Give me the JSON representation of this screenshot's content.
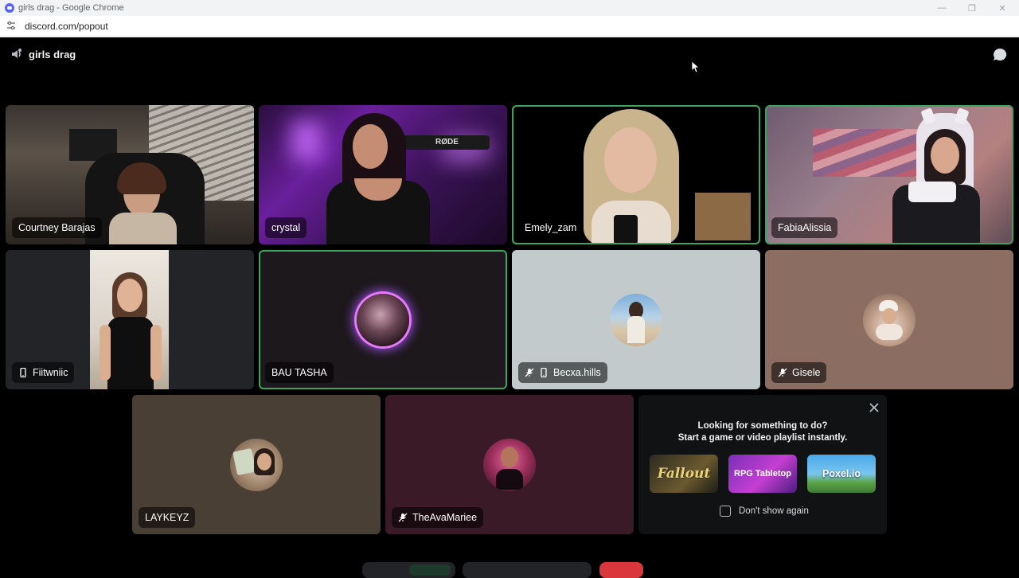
{
  "browser": {
    "window_title": "girls drag - Google Chrome",
    "url": "discord.com/popout",
    "controls": {
      "minimize": "—",
      "restore": "❐",
      "close": "✕"
    }
  },
  "header": {
    "channel_name": "girls drag",
    "voice_icon": "speaker-group-icon",
    "chat_icon": "chat-bubble-icon"
  },
  "participants": [
    {
      "name": "Courtney Barajas",
      "video": true,
      "speaking": false
    },
    {
      "name": "crystal",
      "video": true,
      "speaking": false
    },
    {
      "name": "Emely_zam",
      "video": true,
      "speaking": true
    },
    {
      "name": "FabiaAlissia",
      "video": true,
      "speaking": true
    },
    {
      "name": "Fiitwniic",
      "video": true,
      "mobile": true
    },
    {
      "name": "BAU TASHA",
      "video": false,
      "speaking": true
    },
    {
      "name": "Becxa.hills",
      "video": false,
      "muted": true,
      "mobile": true
    },
    {
      "name": "Gisele",
      "video": false,
      "muted": true
    },
    {
      "name": "LAYKEYZ",
      "video": false
    },
    {
      "name": "TheAvaMariee",
      "video": false,
      "muted": true
    }
  ],
  "activity_panel": {
    "line1": "Looking for something to do?",
    "line2": "Start a game or video playlist instantly.",
    "cards": [
      {
        "title": "Fallout"
      },
      {
        "title": "RPG Tabletop"
      },
      {
        "title": "Poxel.io"
      }
    ],
    "dont_show_label": "Don't show again"
  },
  "colors": {
    "speaking_border": "#3ba55c",
    "leave_button": "#da373c",
    "panel_bg": "#111214"
  }
}
